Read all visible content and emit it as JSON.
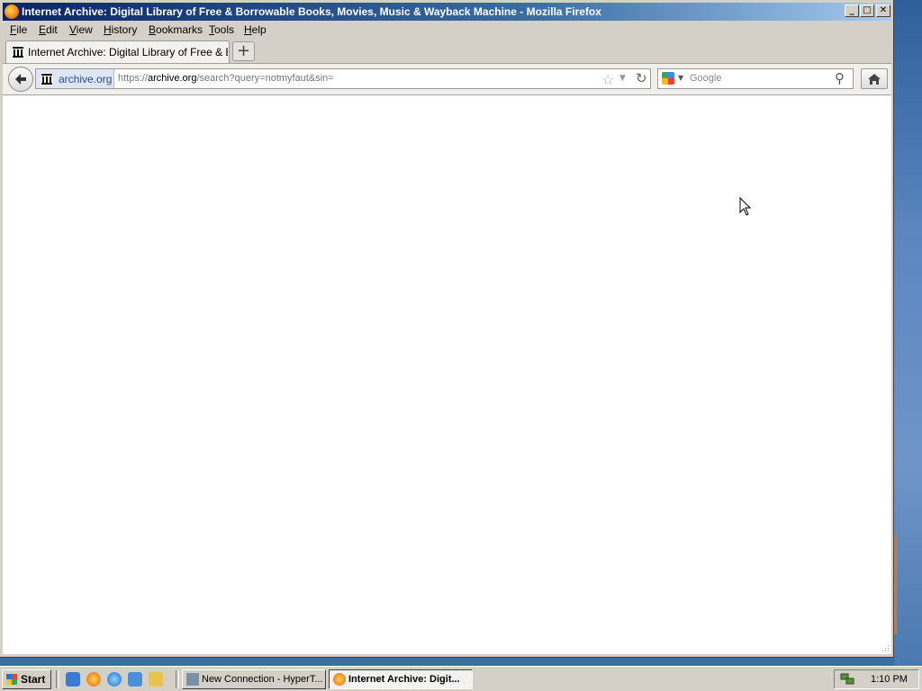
{
  "window": {
    "title": "Internet Archive: Digital Library of Free & Borrowable Books, Movies, Music & Wayback Machine - Mozilla Firefox",
    "minimize_glyph": "_",
    "maximize_glyph": "□",
    "close_glyph": "✕"
  },
  "menubar": {
    "items": [
      {
        "label": "File",
        "accel": "F"
      },
      {
        "label": "Edit",
        "accel": "E"
      },
      {
        "label": "View",
        "accel": "V"
      },
      {
        "label": "History",
        "accel": "H"
      },
      {
        "label": "Bookmarks",
        "accel": "B"
      },
      {
        "label": "Tools",
        "accel": "T"
      },
      {
        "label": "Help",
        "accel": "H"
      }
    ]
  },
  "tabs": [
    {
      "label": "Internet Archive: Digital Library of Free & Bo...",
      "icon": "archive-icon"
    }
  ],
  "new_tab_glyph": "+",
  "navbar": {
    "identity_site": "archive.org",
    "url_scheme": "https://",
    "url_host": "archive.org",
    "url_path": "/search?query=notmyfaut&sin=",
    "search_placeholder": "Google",
    "search_engine_icon": "google-icon"
  },
  "taskbar": {
    "start_label": "Start",
    "quick_launch": [
      "desktop-icon",
      "firefox-icon",
      "ie-icon",
      "outlook-icon",
      "explorer-icon"
    ],
    "tasks": [
      {
        "label": "New Connection - HyperT...",
        "icon": "hyperterminal-icon",
        "active": false
      },
      {
        "label": "Internet Archive: Digit...",
        "icon": "firefox-icon",
        "active": true
      }
    ],
    "clock": "1:10 PM"
  },
  "colors": {
    "title_active": "#0a246a",
    "desktop": "#3a6ea5",
    "chrome_face": "#d4d0c8",
    "identity_text": "#2b4f8c"
  }
}
